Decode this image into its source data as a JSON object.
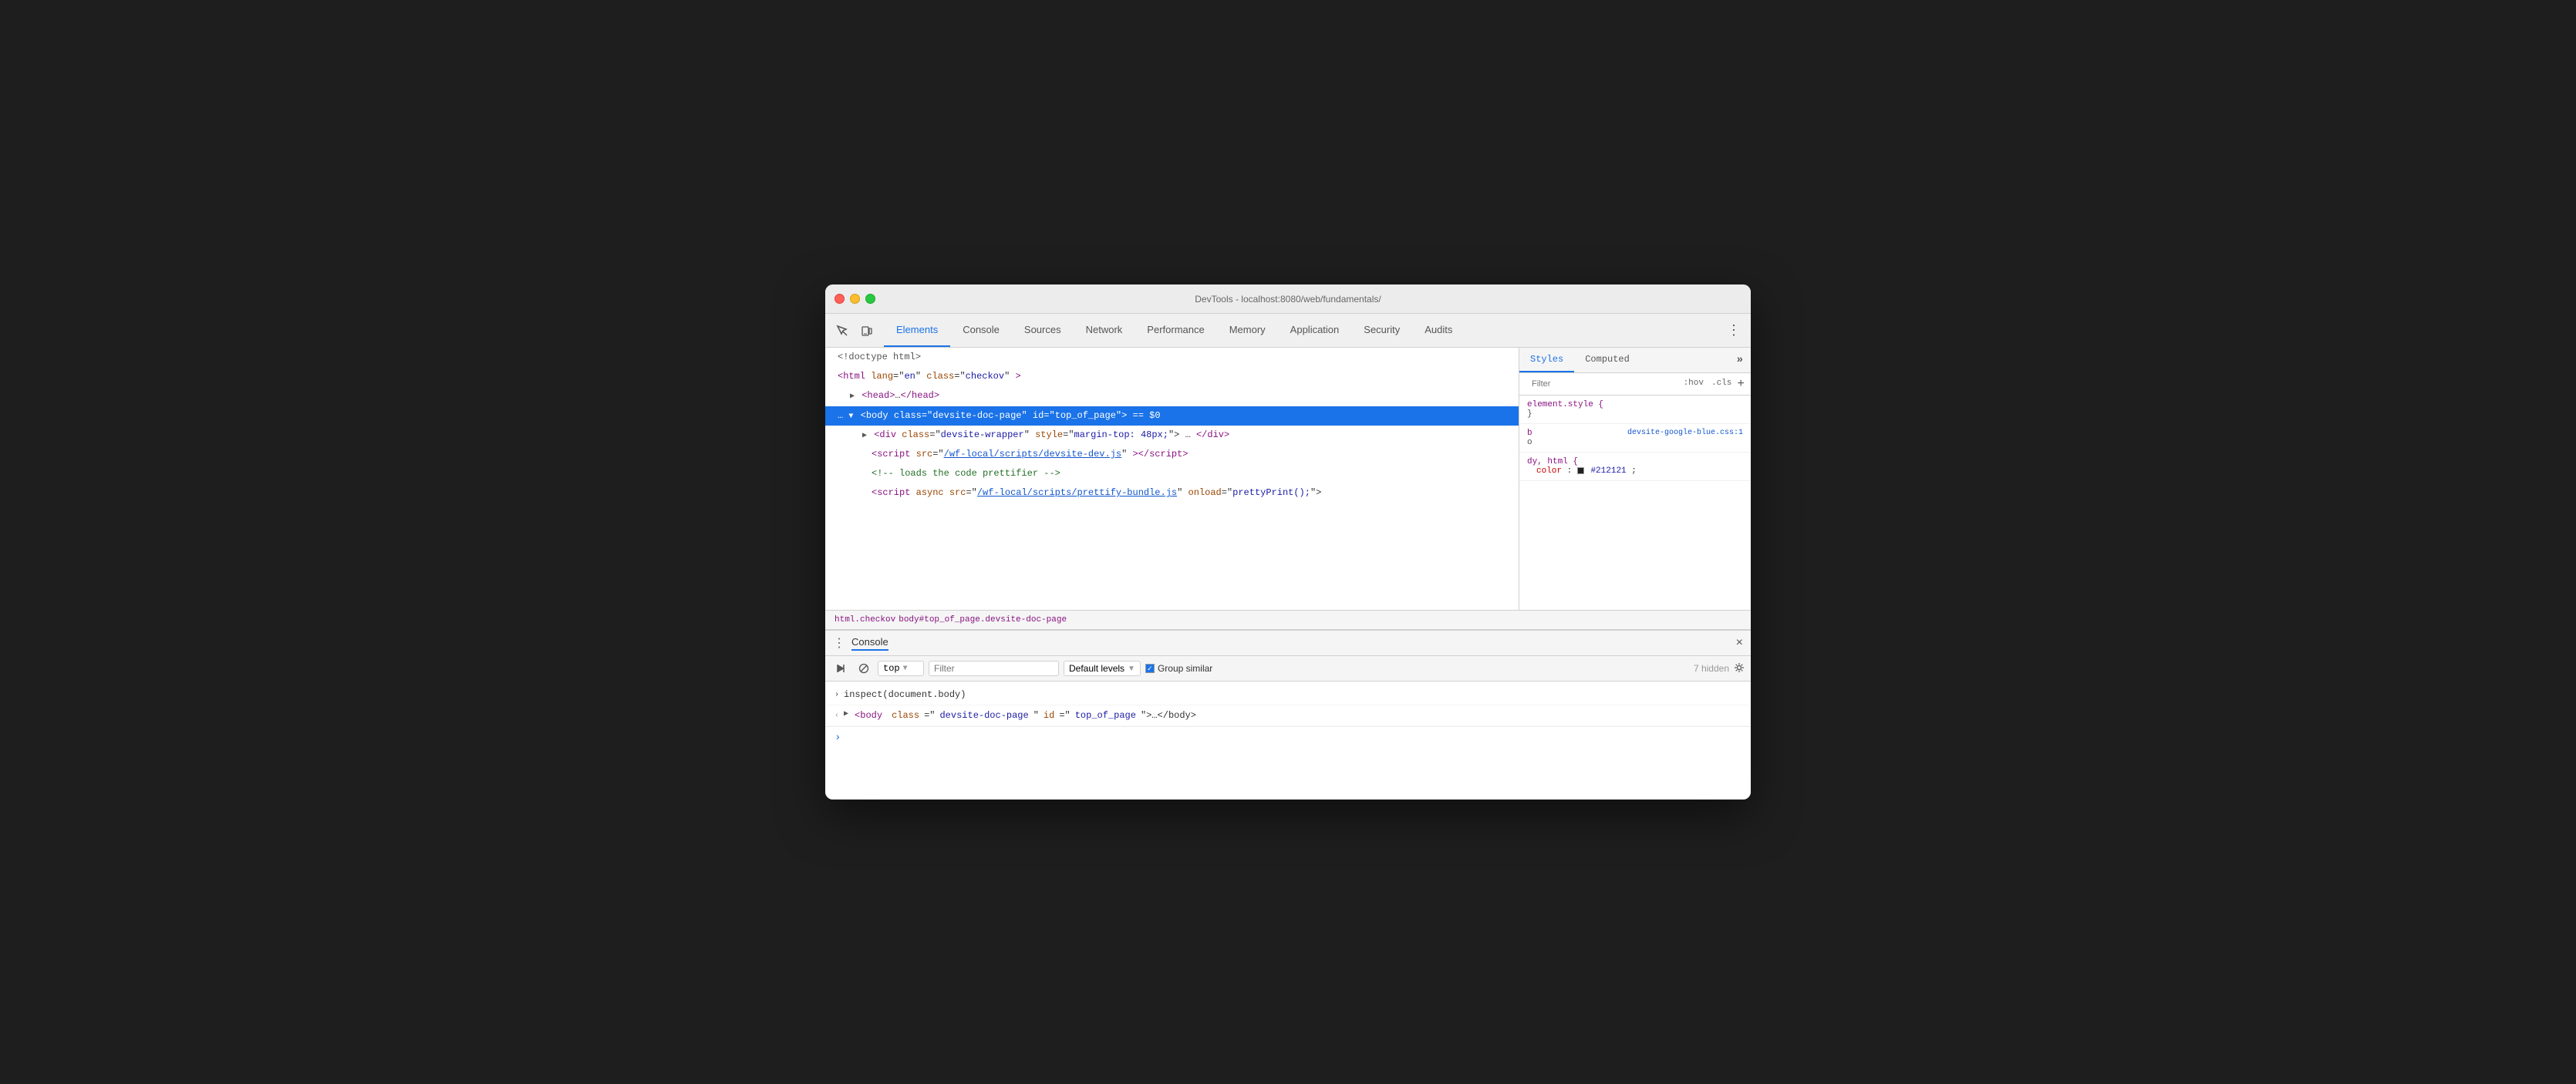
{
  "window": {
    "title": "DevTools - localhost:8080/web/fundamentals/"
  },
  "toolbar": {
    "tabs": [
      {
        "id": "elements",
        "label": "Elements",
        "active": true
      },
      {
        "id": "console",
        "label": "Console",
        "active": false
      },
      {
        "id": "sources",
        "label": "Sources",
        "active": false
      },
      {
        "id": "network",
        "label": "Network",
        "active": false
      },
      {
        "id": "performance",
        "label": "Performance",
        "active": false
      },
      {
        "id": "memory",
        "label": "Memory",
        "active": false
      },
      {
        "id": "application",
        "label": "Application",
        "active": false
      },
      {
        "id": "security",
        "label": "Security",
        "active": false
      },
      {
        "id": "audits",
        "label": "Audits",
        "active": false
      }
    ]
  },
  "elements": {
    "lines": [
      {
        "id": "doctype",
        "indent": 0,
        "content": "<!doctype html>"
      },
      {
        "id": "html",
        "indent": 0,
        "content": "<html lang=\"en\" class=\"checkov\">"
      },
      {
        "id": "head",
        "indent": 1,
        "content": "▶ <head>…</head>"
      },
      {
        "id": "body",
        "indent": 0,
        "content": "<body class=\"devsite-doc-page\" id=\"top_of_page\"> == $0",
        "selected": true,
        "prefix": "… ▼"
      },
      {
        "id": "div",
        "indent": 2,
        "content": "▶ <div class=\"devsite-wrapper\" style=\"margin-top: 48px;\">…</div>"
      },
      {
        "id": "script1",
        "indent": 3,
        "content": "<script src=\"/wf-local/scripts/devsite-dev.js\"><\\/script>"
      },
      {
        "id": "comment",
        "indent": 3,
        "content": "<!-- loads the code prettifier -->"
      },
      {
        "id": "script2",
        "indent": 3,
        "content": "<script async src=\"/wf-local/scripts/prettify-bundle.js\" onload=\"prettyPrint();\">"
      }
    ]
  },
  "breadcrumb": {
    "items": [
      "html.checkov",
      "body#top_of_page.devsite-doc-page"
    ]
  },
  "styles": {
    "tabs": [
      "Styles",
      "Computed"
    ],
    "filter_placeholder": "Filter",
    "filter_hov": ":hov",
    "filter_cls": ".cls",
    "rules": [
      {
        "selector": "element.style",
        "source": "",
        "properties": []
      },
      {
        "selector": "b",
        "source": "devsite-google-blue.css:1",
        "source_suffix": "o",
        "properties": []
      },
      {
        "selector": "dy, html",
        "source": "",
        "properties": [
          {
            "name": "color",
            "value": "#212121",
            "has_swatch": true,
            "swatch_color": "#212121"
          }
        ]
      }
    ]
  },
  "console_panel": {
    "title": "Console",
    "close_label": "×",
    "toolbar": {
      "execute_label": "▶",
      "block_label": "⊘",
      "context_label": "top",
      "filter_placeholder": "Filter",
      "levels_label": "Default levels",
      "group_similar_label": "Group similar",
      "hidden_label": "7 hidden"
    },
    "lines": [
      {
        "type": "input",
        "arrow": "›",
        "text": "inspect(document.body)"
      },
      {
        "type": "output",
        "arrow": "‹",
        "text": "<body class=\"devsite-doc-page\" id=\"top_of_page\">…</body>"
      }
    ],
    "cursor_label": "›"
  }
}
